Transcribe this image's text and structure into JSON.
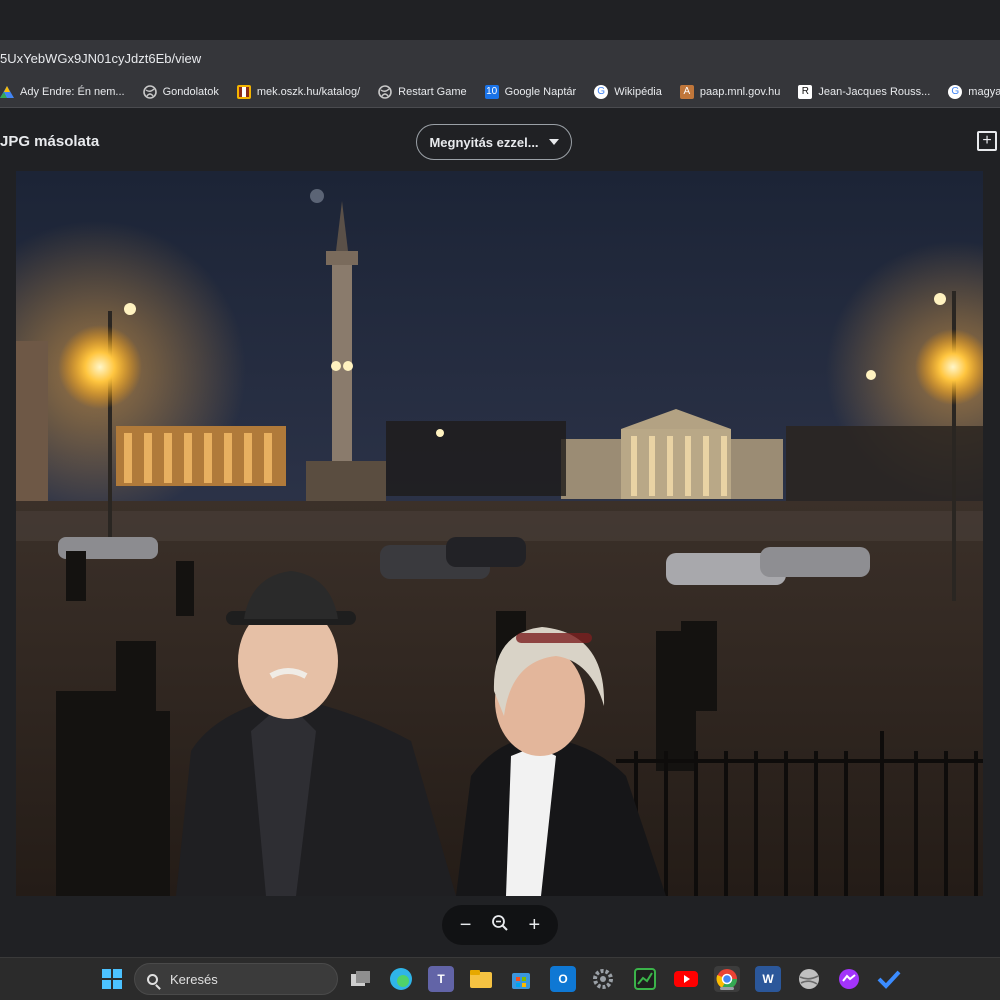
{
  "browser": {
    "url": "5UxYebWGx9JN01cyJdzt6Eb/view",
    "bookmarks": [
      {
        "label": "Ady Endre: Én nem...",
        "icon": "drive-icon",
        "color": "#4285f4"
      },
      {
        "label": "Gondolatok",
        "icon": "globe-icon",
        "color": "#9aa0a6"
      },
      {
        "label": "mek.oszk.hu/katalog/",
        "icon": "mek-icon",
        "color": "#f4b400"
      },
      {
        "label": "Restart Game",
        "icon": "globe-icon",
        "color": "#9aa0a6"
      },
      {
        "label": "Google Naptár",
        "icon": "calendar-icon",
        "color": "#1a73e8",
        "glyph": "10"
      },
      {
        "label": "Wikipédia",
        "icon": "google-icon",
        "color": "#ffffff",
        "glyph": "G"
      },
      {
        "label": "paap.mnl.gov.hu",
        "icon": "mnl-icon",
        "color": "#c0763a",
        "glyph": "A"
      },
      {
        "label": "Jean-Jacques Rouss...",
        "icon": "r-icon",
        "color": "#ffffff",
        "glyph": "R"
      },
      {
        "label": "magyar",
        "icon": "google-icon",
        "color": "#ffffff",
        "glyph": "G"
      }
    ]
  },
  "viewer": {
    "file_title": "JPG másolata",
    "open_with_label": "Megnyitás ezzel...",
    "zoom_out": "−",
    "zoom_icon": "zoom-icon",
    "zoom_in": "+"
  },
  "taskbar": {
    "search_label": "Keresés",
    "apps": [
      {
        "name": "windows-start",
        "color": "#4cc2ff"
      },
      {
        "name": "task-view",
        "color": "#cfcfcf"
      },
      {
        "name": "edge",
        "color": "#2fb5e8"
      },
      {
        "name": "teams",
        "color": "#6264a7"
      },
      {
        "name": "file-explorer",
        "color": "#f5c242"
      },
      {
        "name": "microsoft-store",
        "color": "#3a96dd"
      },
      {
        "name": "outlook",
        "color": "#0f78d4"
      },
      {
        "name": "settings",
        "color": "#9aa0a6"
      },
      {
        "name": "money-app",
        "color": "#3bb34a"
      },
      {
        "name": "youtube",
        "color": "#ff0000"
      },
      {
        "name": "chrome",
        "color": "#34a853"
      },
      {
        "name": "word",
        "color": "#2b579a"
      },
      {
        "name": "globe-app",
        "color": "#c0c0c0"
      },
      {
        "name": "messenger",
        "color": "#a334fa"
      },
      {
        "name": "todo",
        "color": "#3b8cff"
      }
    ]
  }
}
